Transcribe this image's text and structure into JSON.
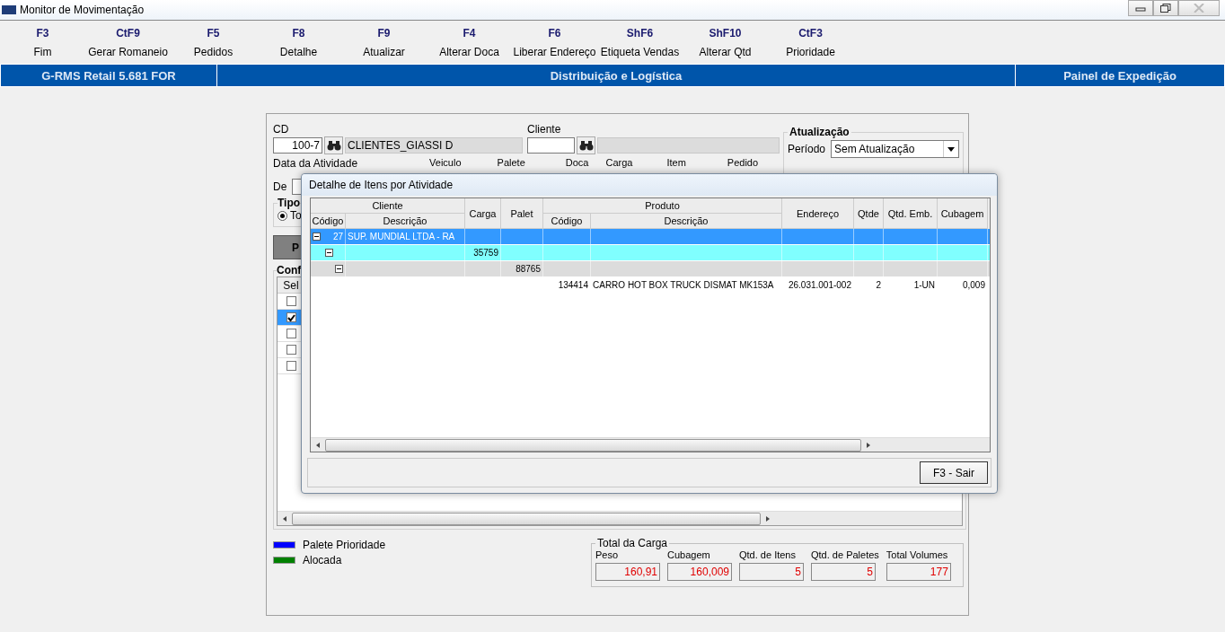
{
  "window": {
    "title": "Monitor de Movimentação"
  },
  "toolbar": [
    {
      "key": "F3",
      "label": "Fim"
    },
    {
      "key": "CtF9",
      "label": "Gerar Romaneio"
    },
    {
      "key": "F5",
      "label": "Pedidos"
    },
    {
      "key": "F8",
      "label": "Detalhe"
    },
    {
      "key": "F9",
      "label": "Atualizar"
    },
    {
      "key": "F4",
      "label": "Alterar Doca"
    },
    {
      "key": "F6",
      "label": "Liberar Endereço"
    },
    {
      "key": "ShF6",
      "label": "Etiqueta Vendas"
    },
    {
      "key": "ShF10",
      "label": "Alterar Qtd"
    },
    {
      "key": "CtF3",
      "label": "Prioridade"
    }
  ],
  "header_bar": {
    "product": "G-RMS Retail 5.681 FOR",
    "module": "Distribuição e Logística",
    "screen": "Painel de Expedição"
  },
  "filters": {
    "cd_label": "CD",
    "cd_value": "100-7",
    "cd_name": "CLIENTES_GIASSI D",
    "cliente_label": "Cliente",
    "data_label": "Data da Atividade",
    "de_label": "De",
    "column_labels": [
      "Veiculo",
      "Palete",
      "Doca",
      "Carga",
      "Item",
      "Pedido"
    ],
    "tipo_label": "Tipo",
    "tipo_option": {
      "label": "To",
      "selected": true
    },
    "button_label": "P"
  },
  "atualizacao": {
    "title": "Atualização",
    "periodo_label": "Período",
    "periodo_value": "Sem Atualização"
  },
  "conf": {
    "title": "Conf",
    "sel_header": "Sel",
    "rows": [
      {
        "checked": false,
        "selected": false
      },
      {
        "checked": true,
        "selected": true
      },
      {
        "checked": false,
        "selected": false
      },
      {
        "checked": false,
        "selected": false
      },
      {
        "checked": false,
        "selected": false
      }
    ]
  },
  "legend": [
    {
      "label": "Palete Prioridade",
      "color": "#0000ff"
    },
    {
      "label": "Alocada",
      "color": "#008000"
    }
  ],
  "totals": {
    "title": "Total da Carga",
    "fields": [
      {
        "label": "Peso",
        "value": "160,91"
      },
      {
        "label": "Cubagem",
        "value": "160,009"
      },
      {
        "label": "Qtd. de Itens",
        "value": "5"
      },
      {
        "label": "Qtd. de Paletes",
        "value": "5"
      },
      {
        "label": "Total Volumes",
        "value": "177"
      }
    ]
  },
  "dialog": {
    "title": "Detalhe de Itens por Atividade",
    "groups": [
      {
        "label": "Cliente",
        "columns": [
          "Código",
          "Descrição"
        ]
      },
      {
        "label": "Carga"
      },
      {
        "label": "Palet"
      },
      {
        "label": "Produto",
        "columns": [
          "Código",
          "Descrição"
        ]
      },
      {
        "label": "Endereço"
      },
      {
        "label": "Qtde"
      },
      {
        "label": "Qtd. Emb."
      },
      {
        "label": "Cubagem"
      }
    ],
    "rows": [
      {
        "codigo": "27",
        "descricao": "SUP. MUNDIAL LTDA  -  RA",
        "expanded": true,
        "children": [
          {
            "carga": "35759",
            "expanded": true,
            "children": [
              {
                "palet": "88765",
                "expanded": true,
                "children": [
                  {
                    "produto_codigo": "134414",
                    "produto_descricao": "CARRO HOT BOX TRUCK DISMAT MK153A",
                    "endereco": "26.031.001-002",
                    "qtde": "2",
                    "qtd_emb": "1-UN",
                    "cubagem": "0,009"
                  }
                ]
              }
            ]
          }
        ]
      }
    ],
    "button": "F3 - Sair"
  }
}
